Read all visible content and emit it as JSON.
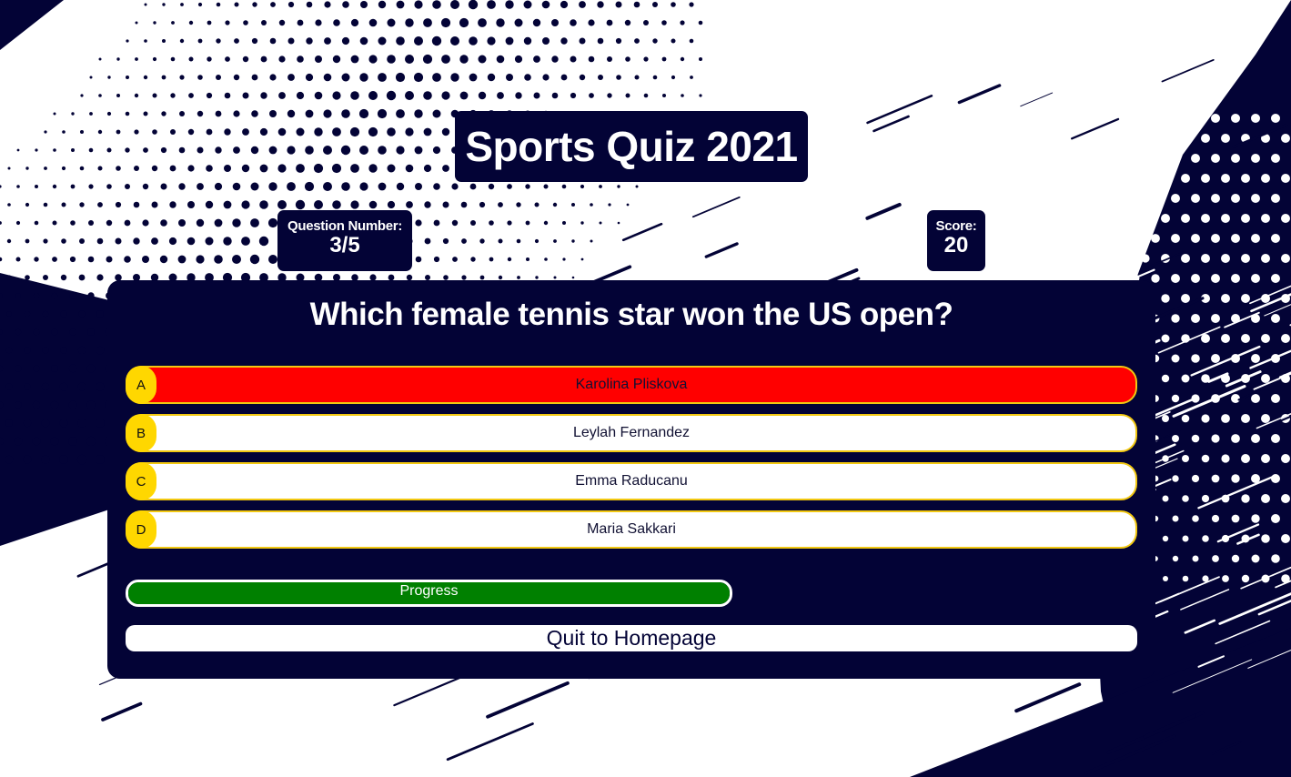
{
  "header": {
    "title": "Sports Quiz 2021"
  },
  "stats": {
    "question_label": "Question Number:",
    "question_value": "3/5",
    "score_label": "Score:",
    "score_value": "20"
  },
  "quiz": {
    "question": "Which female tennis star won the US open?",
    "options": [
      {
        "letter": "A",
        "text": "Karolina Pliskova",
        "state": "wrong"
      },
      {
        "letter": "B",
        "text": "Leylah Fernandez",
        "state": "none"
      },
      {
        "letter": "C",
        "text": "Emma Raducanu",
        "state": "none"
      },
      {
        "letter": "D",
        "text": "Maria Sakkari",
        "state": "none"
      }
    ],
    "progress_label": "Progress",
    "progress_fraction": 1.0,
    "quit_label": "Quit to Homepage"
  },
  "colors": {
    "navy": "#030336",
    "option_border": "#f2c811",
    "letter_badge": "#ffd700",
    "wrong_answer": "#ff0000",
    "progress": "#008000"
  }
}
